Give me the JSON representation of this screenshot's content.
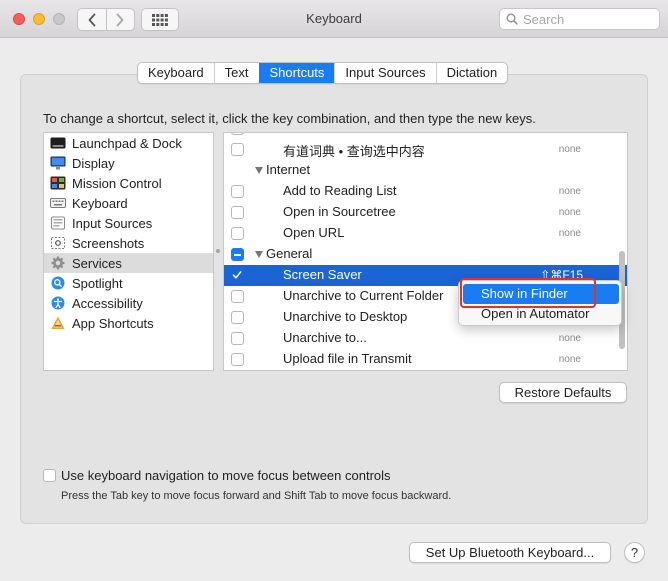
{
  "window": {
    "title": "Keyboard"
  },
  "search": {
    "placeholder": "Search"
  },
  "tabs": [
    {
      "label": "Keyboard",
      "active": false
    },
    {
      "label": "Text",
      "active": false
    },
    {
      "label": "Shortcuts",
      "active": true
    },
    {
      "label": "Input Sources",
      "active": false
    },
    {
      "label": "Dictation",
      "active": false
    }
  ],
  "instruction": "To change a shortcut, select it, click the key combination, and then type the new keys.",
  "categories": [
    {
      "label": "Launchpad & Dock",
      "icon": "launchpad-dock-icon"
    },
    {
      "label": "Display",
      "icon": "display-icon"
    },
    {
      "label": "Mission Control",
      "icon": "mission-control-icon"
    },
    {
      "label": "Keyboard",
      "icon": "keyboard-icon"
    },
    {
      "label": "Input Sources",
      "icon": "input-sources-icon"
    },
    {
      "label": "Screenshots",
      "icon": "screenshots-icon"
    },
    {
      "label": "Services",
      "icon": "gear-icon",
      "selected": true
    },
    {
      "label": "Spotlight",
      "icon": "spotlight-icon"
    },
    {
      "label": "Accessibility",
      "icon": "accessibility-icon"
    },
    {
      "label": "App Shortcuts",
      "icon": "app-shortcuts-icon"
    }
  ],
  "shortcuts": {
    "rows": [
      {
        "type": "item",
        "label": "有道词典 • 查询选中内容",
        "keys": "none"
      },
      {
        "type": "group",
        "label": "Internet"
      },
      {
        "type": "item",
        "label": "Add to Reading List",
        "keys": "none"
      },
      {
        "type": "item",
        "label": "Open in Sourcetree",
        "keys": "none"
      },
      {
        "type": "item",
        "label": "Open URL",
        "keys": "none"
      },
      {
        "type": "group",
        "label": "General"
      },
      {
        "type": "item",
        "label": "Screen Saver",
        "keys": "⇧⌘F15",
        "selected": true
      },
      {
        "type": "item",
        "label": "Unarchive to Current Folder",
        "keys": ""
      },
      {
        "type": "item",
        "label": "Unarchive to Desktop",
        "keys": ""
      },
      {
        "type": "item",
        "label": "Unarchive to...",
        "keys": "none"
      },
      {
        "type": "item",
        "label": "Upload file in Transmit",
        "keys": "none"
      }
    ]
  },
  "context_menu": {
    "items": [
      {
        "label": "Show in Finder",
        "highlighted": true
      },
      {
        "label": "Open in Automator",
        "highlighted": false
      }
    ]
  },
  "buttons": {
    "restore_defaults": "Restore Defaults",
    "bluetooth": "Set Up Bluetooth Keyboard...",
    "help": "?"
  },
  "keyboard_nav": {
    "label": "Use keyboard navigation to move focus between controls",
    "help": "Press the Tab key to move focus forward and Shift Tab to move focus backward."
  },
  "colors": {
    "accent": "#1a7cf3",
    "selection": "#1a64d6",
    "annotation": "#e0302f"
  }
}
